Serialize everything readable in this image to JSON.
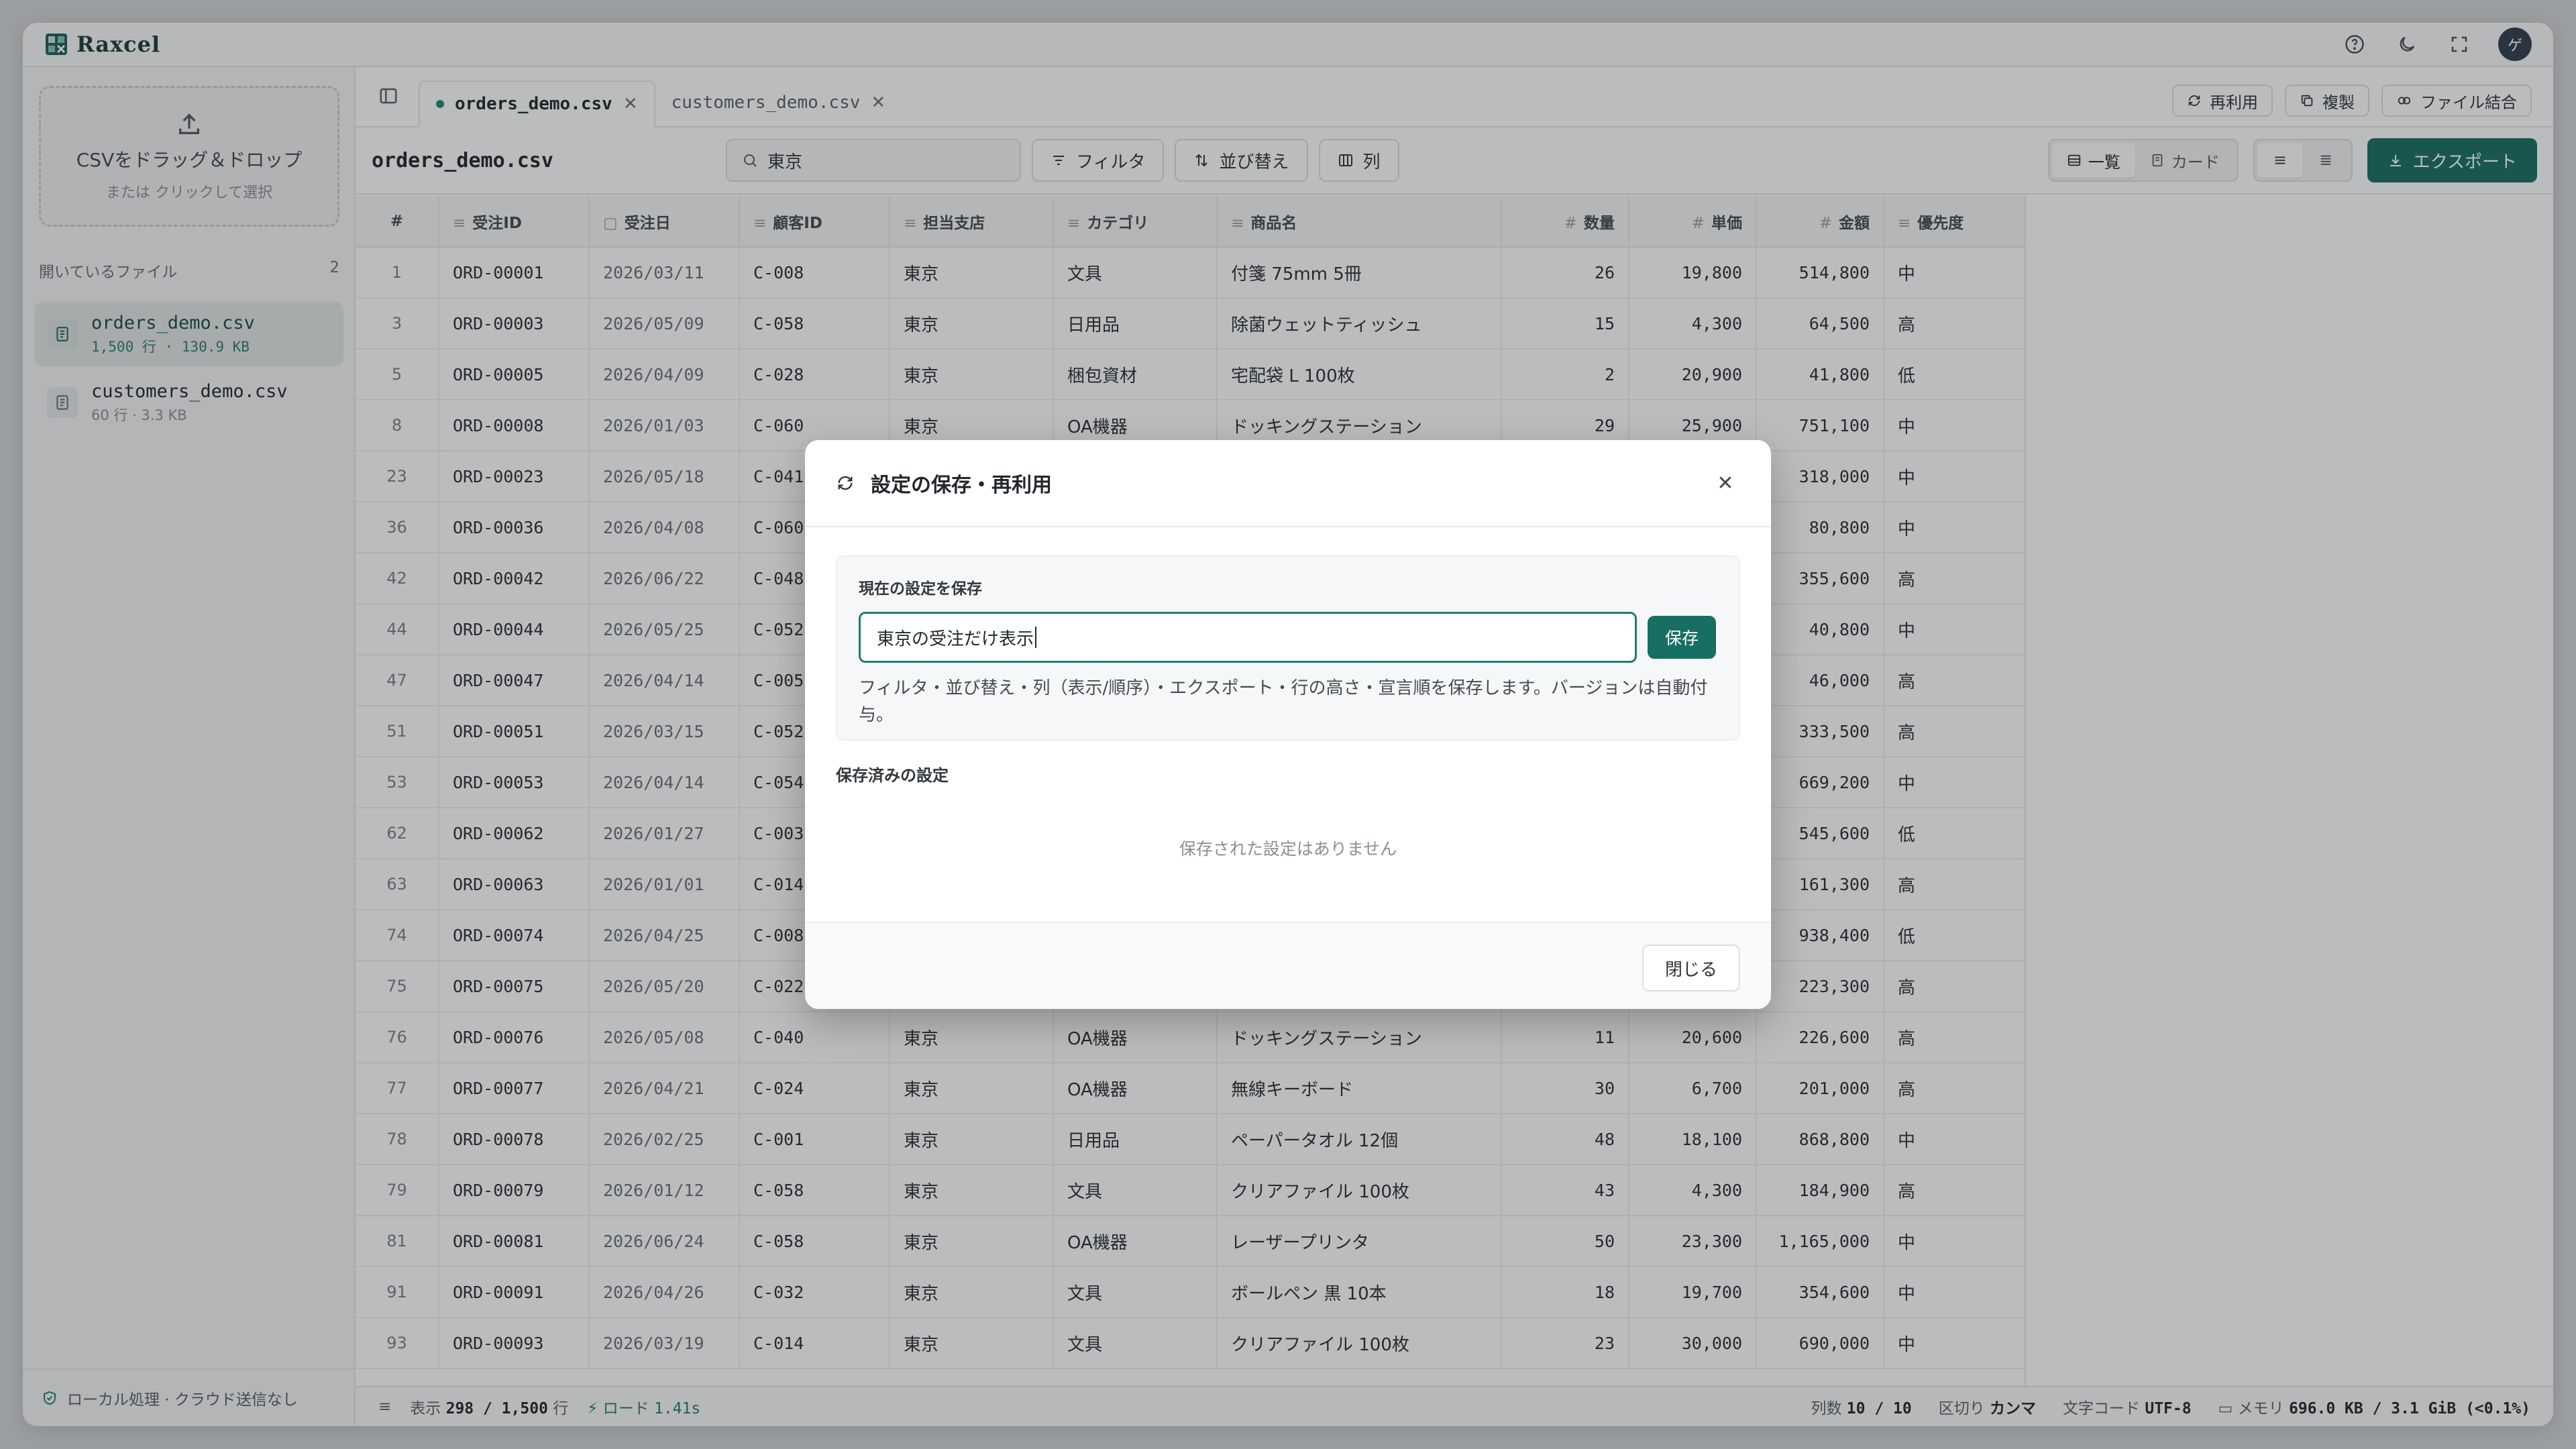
{
  "app": {
    "name": "Raxcel",
    "avatar_initial": "ゲ"
  },
  "top_icons": [
    "help-icon",
    "moon-icon",
    "fullscreen-icon"
  ],
  "sidebar": {
    "dropzone_title": "CSVをドラッグ＆ドロップ",
    "dropzone_sub": "または クリックして選択",
    "section_title": "開いているファイル",
    "section_count": "2",
    "files": [
      {
        "name": "orders_demo.csv",
        "meta": "1,500 行 · 130.9 KB"
      },
      {
        "name": "customers_demo.csv",
        "meta": "60 行 · 3.3 KB"
      }
    ],
    "footer": "ローカル処理 · クラウド送信なし"
  },
  "tabs": [
    {
      "label": "orders_demo.csv"
    },
    {
      "label": "customers_demo.csv"
    }
  ],
  "tab_actions": {
    "reuse": "再利用",
    "duplicate": "複製",
    "join": "ファイル結合"
  },
  "toolbar": {
    "file_title": "orders_demo.csv",
    "search_value": "東京",
    "filter": "フィルタ",
    "sort": "並び替え",
    "columns": "列",
    "view_list": "一覧",
    "view_card": "カード",
    "export": "エクスポート"
  },
  "table": {
    "headers": [
      "#",
      "受注ID",
      "受注日",
      "顧客ID",
      "担当支店",
      "カテゴリ",
      "商品名",
      "数量",
      "単価",
      "金額",
      "優先度"
    ],
    "header_icons": [
      "",
      "≡",
      "▢",
      "≡",
      "≡",
      "≡",
      "≡",
      "#",
      "#",
      "#",
      "≡"
    ],
    "rows": [
      [
        "1",
        "ORD-00001",
        "2026/03/11",
        "C-008",
        "東京",
        "文具",
        "付箋 75mm 5冊",
        "26",
        "19,800",
        "514,800",
        "中"
      ],
      [
        "3",
        "ORD-00003",
        "2026/05/09",
        "C-058",
        "東京",
        "日用品",
        "除菌ウェットティッシュ",
        "15",
        "4,300",
        "64,500",
        "高"
      ],
      [
        "5",
        "ORD-00005",
        "2026/04/09",
        "C-028",
        "東京",
        "梱包資材",
        "宅配袋 L 100枚",
        "2",
        "20,900",
        "41,800",
        "低"
      ],
      [
        "8",
        "ORD-00008",
        "2026/01/03",
        "C-060",
        "東京",
        "OA機器",
        "ドッキングステーション",
        "29",
        "25,900",
        "751,100",
        "中"
      ],
      [
        "23",
        "ORD-00023",
        "2026/05/18",
        "C-041",
        "",
        "",
        "",
        "",
        "",
        "318,000",
        "中"
      ],
      [
        "36",
        "ORD-00036",
        "2026/04/08",
        "C-060",
        "",
        "",
        "",
        "",
        "",
        "80,800",
        "中"
      ],
      [
        "42",
        "ORD-00042",
        "2026/06/22",
        "C-048",
        "",
        "",
        "",
        "",
        "",
        "355,600",
        "高"
      ],
      [
        "44",
        "ORD-00044",
        "2026/05/25",
        "C-052",
        "",
        "",
        "",
        "",
        "",
        "40,800",
        "中"
      ],
      [
        "47",
        "ORD-00047",
        "2026/04/14",
        "C-005",
        "",
        "",
        "",
        "",
        "",
        "46,000",
        "高"
      ],
      [
        "51",
        "ORD-00051",
        "2026/03/15",
        "C-052",
        "",
        "",
        "",
        "",
        "",
        "333,500",
        "高"
      ],
      [
        "53",
        "ORD-00053",
        "2026/04/14",
        "C-054",
        "",
        "",
        "",
        "",
        "",
        "669,200",
        "中"
      ],
      [
        "62",
        "ORD-00062",
        "2026/01/27",
        "C-003",
        "",
        "",
        "",
        "",
        "",
        "545,600",
        "低"
      ],
      [
        "63",
        "ORD-00063",
        "2026/01/01",
        "C-014",
        "",
        "",
        "",
        "",
        "",
        "161,300",
        "高"
      ],
      [
        "74",
        "ORD-00074",
        "2026/04/25",
        "C-008",
        "",
        "",
        "",
        "",
        "",
        "938,400",
        "低"
      ],
      [
        "75",
        "ORD-00075",
        "2026/05/20",
        "C-022",
        "",
        "",
        "",
        "",
        "",
        "223,300",
        "高"
      ],
      [
        "76",
        "ORD-00076",
        "2026/05/08",
        "C-040",
        "東京",
        "OA機器",
        "ドッキングステーション",
        "11",
        "20,600",
        "226,600",
        "高"
      ],
      [
        "77",
        "ORD-00077",
        "2026/04/21",
        "C-024",
        "東京",
        "OA機器",
        "無線キーボード",
        "30",
        "6,700",
        "201,000",
        "高"
      ],
      [
        "78",
        "ORD-00078",
        "2026/02/25",
        "C-001",
        "東京",
        "日用品",
        "ペーパータオル 12個",
        "48",
        "18,100",
        "868,800",
        "中"
      ],
      [
        "79",
        "ORD-00079",
        "2026/01/12",
        "C-058",
        "東京",
        "文具",
        "クリアファイル 100枚",
        "43",
        "4,300",
        "184,900",
        "高"
      ],
      [
        "81",
        "ORD-00081",
        "2026/06/24",
        "C-058",
        "東京",
        "OA機器",
        "レーザープリンタ",
        "50",
        "23,300",
        "1,165,000",
        "中"
      ],
      [
        "91",
        "ORD-00091",
        "2026/04/26",
        "C-032",
        "東京",
        "文具",
        "ボールペン 黒 10本",
        "18",
        "19,700",
        "354,600",
        "中"
      ],
      [
        "93",
        "ORD-00093",
        "2026/03/19",
        "C-014",
        "東京",
        "文具",
        "クリアファイル 100枚",
        "23",
        "30,000",
        "690,000",
        "中"
      ]
    ]
  },
  "status": {
    "shown_label": "表示",
    "shown": "298 / 1,500",
    "rows_unit": "行",
    "load_label": "ロード",
    "load_time": "1.41s",
    "cols_label": "列数",
    "cols": "10 / 10",
    "delim_label": "区切り",
    "delim": "カンマ",
    "enc_label": "文字コード",
    "enc": "UTF-8",
    "mem_label": "メモリ",
    "mem": "696.0 KB / 3.1 GiB (<0.1%)"
  },
  "modal": {
    "title": "設定の保存・再利用",
    "save_section": "現在の設定を保存",
    "input_value": "東京の受注だけ表示",
    "save_button": "保存",
    "help": "フィルタ・並び替え・列（表示/順序）・エクスポート・行の高さ・宣言順を保存します。バージョンは自動付与。",
    "saved_section": "保存済みの設定",
    "empty": "保存された設定はありません",
    "close_button": "閉じる"
  },
  "colors": {
    "accent": "#176e62",
    "accent_light": "#1f8a78"
  }
}
